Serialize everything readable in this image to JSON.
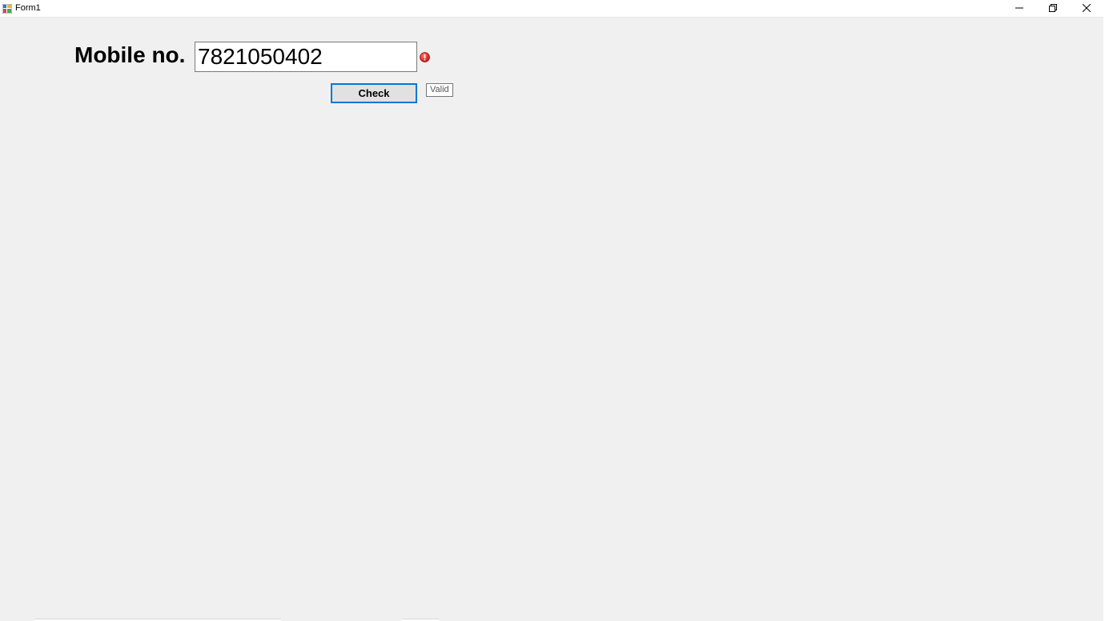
{
  "window": {
    "title": "Form1",
    "icon": "form-app-icon",
    "controls": {
      "minimize_icon": "minimize-icon",
      "restore_icon": "restore-icon",
      "close_icon": "close-icon"
    }
  },
  "form": {
    "mobile_label": "Mobile no.",
    "mobile_value": "7821050402",
    "error_icon": "error-icon",
    "error_color": "#e81123",
    "check_button_label": "Check",
    "tooltip_text": "Valid",
    "focus_color": "#0078d7"
  }
}
